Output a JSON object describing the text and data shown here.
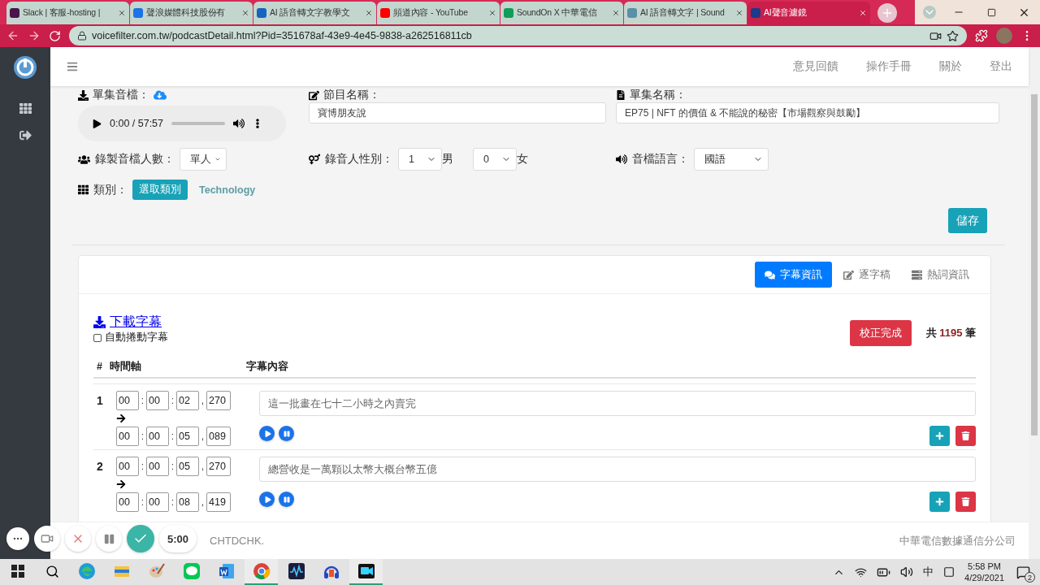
{
  "browser": {
    "tabs": [
      {
        "label": "Slack | 客服-hosting |",
        "selected": false,
        "color": "#4a154b"
      },
      {
        "label": "聲浪媒體科技股份有",
        "selected": false,
        "color": "#1a73e8"
      },
      {
        "label": "AI 語音轉文字教學文",
        "selected": false,
        "color": "#1565c0"
      },
      {
        "label": "頻道內容 - YouTube",
        "selected": false,
        "color": "#ff0000"
      },
      {
        "label": "SoundOn X 中華電信",
        "selected": false,
        "color": "#0f9d58"
      },
      {
        "label": "AI 語音轉文字 | Sound",
        "selected": false,
        "color": "#5a8fa8"
      },
      {
        "label": "AI聲音濾鏡",
        "selected": true,
        "color": "#1e3a8a"
      }
    ],
    "url": "voicefilter.com.tw/podcastDetail.html?Pid=351678af-43e9-4e45-9838-a262516811cb"
  },
  "navbar": {
    "links": [
      "意見回饋",
      "操作手冊",
      "關於",
      "登出"
    ]
  },
  "form": {
    "audio_label": "單集音檔：",
    "player_time": "0:00 / 57:57",
    "program_label": "節目名稱：",
    "program_value": "寶博朋友說",
    "episode_label": "單集名稱：",
    "episode_value": "EP75 | NFT 的價值 & 不能說的秘密【市場觀察與鼓勵】",
    "speakers_label": "錄製音檔人數：",
    "speakers_value": "單人",
    "gender_label": "錄音人性別：",
    "male_count": "1",
    "male_label": "男",
    "female_count": "0",
    "female_label": "女",
    "language_label": "音檔語言：",
    "language_value": "國語",
    "category_label": "類別：",
    "category_button": "選取類別",
    "category_value": "Technology",
    "save": "儲存"
  },
  "subtitle_panel": {
    "tabs": [
      {
        "label": "字幕資訊",
        "selected": true
      },
      {
        "label": "逐字稿",
        "selected": false
      },
      {
        "label": "熱詞資訊",
        "selected": false
      }
    ],
    "download": "下載字幕",
    "auto_scroll": {
      "label": "自動捲動字幕",
      "checked": false
    },
    "finish": "校正完成",
    "total_prefix": "共",
    "total": "1195",
    "total_suffix": "筆",
    "columns": [
      "#",
      "時間軸",
      "字幕內容"
    ],
    "rows": [
      {
        "index": "1",
        "start": [
          "00",
          ":",
          "00",
          ":",
          "02",
          ",",
          "270"
        ],
        "end": [
          "00",
          ":",
          "00",
          ":",
          "05",
          ",",
          "089"
        ],
        "text": "這一批畫在七十二小時之內賣完"
      },
      {
        "index": "2",
        "start": [
          "00",
          ":",
          "00",
          ":",
          "05",
          ",",
          "270"
        ],
        "end": [
          "00",
          ":",
          "00",
          ":",
          "08",
          ",",
          "419"
        ],
        "text": "總營收是一萬顆以太幣大概台幣五億"
      }
    ]
  },
  "footer": {
    "left": "CHTDCHK.",
    "right": "中華電信數據通信分公司"
  },
  "recorder": {
    "timer": "5:00"
  },
  "taskbar": {
    "apps": [
      {
        "kind": "edge",
        "active": false
      },
      {
        "kind": "folder",
        "active": false
      },
      {
        "kind": "paint",
        "active": false
      },
      {
        "kind": "line",
        "active": false
      },
      {
        "kind": "word",
        "active": false
      },
      {
        "kind": "chrome",
        "active": true
      },
      {
        "kind": "wave",
        "active": false
      },
      {
        "kind": "audio",
        "active": false
      },
      {
        "kind": "recorder",
        "active": true
      }
    ],
    "ime": "中",
    "time": "5:58 PM",
    "date": "4/29/2021",
    "notifications": "2"
  }
}
